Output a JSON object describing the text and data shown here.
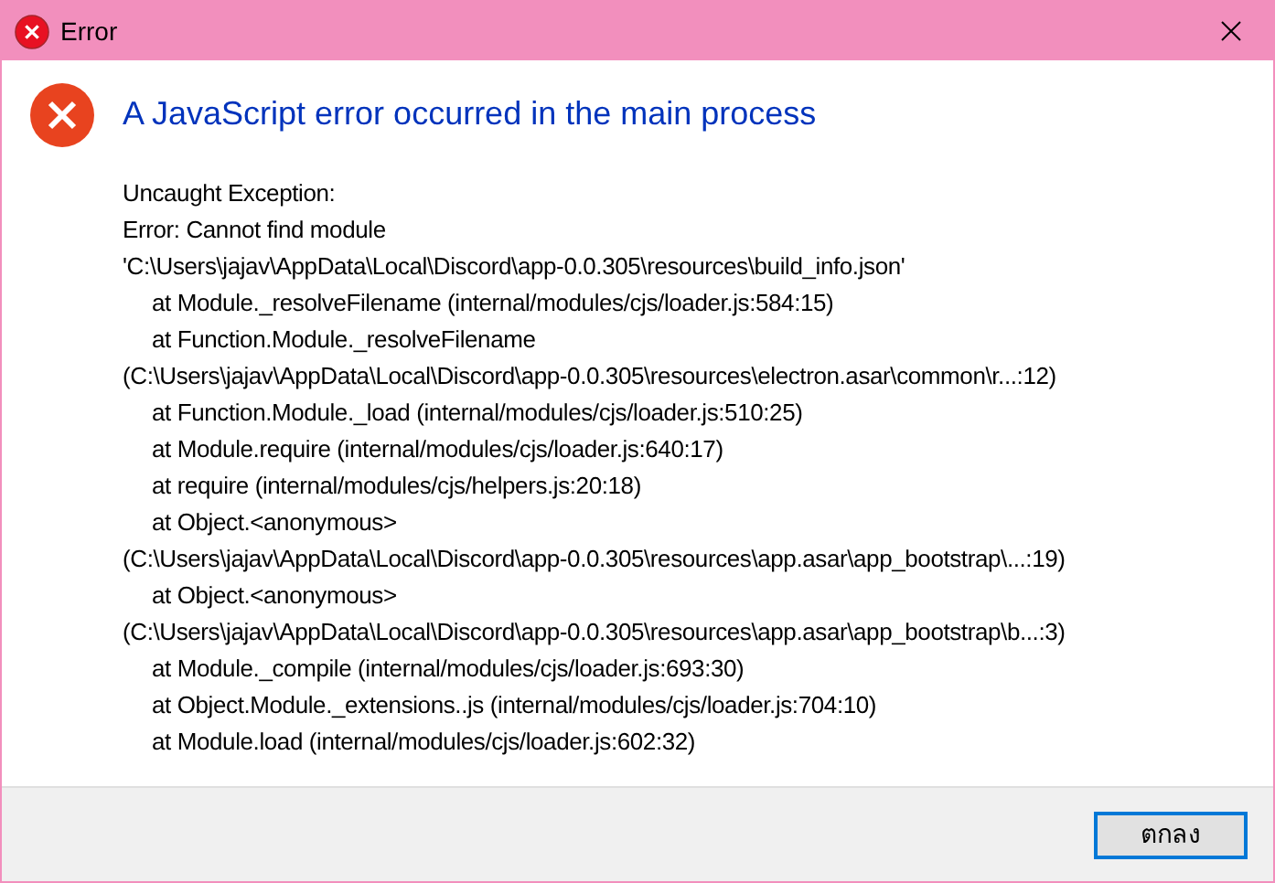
{
  "window": {
    "title": "Error"
  },
  "heading": "A JavaScript error occurred in the main process",
  "message_lines": [
    {
      "text": "Uncaught Exception:",
      "indent": false
    },
    {
      "text": "Error: Cannot find module",
      "indent": false
    },
    {
      "text": "'C:\\Users\\jajav\\AppData\\Local\\Discord\\app-0.0.305\\resources\\build_info.json'",
      "indent": false
    },
    {
      "text": "at Module._resolveFilename (internal/modules/cjs/loader.js:584:15)",
      "indent": true
    },
    {
      "text": "at Function.Module._resolveFilename",
      "indent": true
    },
    {
      "text": "(C:\\Users\\jajav\\AppData\\Local\\Discord\\app-0.0.305\\resources\\electron.asar\\common\\r...:12)",
      "indent": false
    },
    {
      "text": "at Function.Module._load (internal/modules/cjs/loader.js:510:25)",
      "indent": true
    },
    {
      "text": "at Module.require (internal/modules/cjs/loader.js:640:17)",
      "indent": true
    },
    {
      "text": "at require (internal/modules/cjs/helpers.js:20:18)",
      "indent": true
    },
    {
      "text": "at Object.<anonymous>",
      "indent": true
    },
    {
      "text": "(C:\\Users\\jajav\\AppData\\Local\\Discord\\app-0.0.305\\resources\\app.asar\\app_bootstrap\\...:19)",
      "indent": false
    },
    {
      "text": "at Object.<anonymous>",
      "indent": true
    },
    {
      "text": "(C:\\Users\\jajav\\AppData\\Local\\Discord\\app-0.0.305\\resources\\app.asar\\app_bootstrap\\b...:3)",
      "indent": false
    },
    {
      "text": "at Module._compile (internal/modules/cjs/loader.js:693:30)",
      "indent": true
    },
    {
      "text": "at Object.Module._extensions..js (internal/modules/cjs/loader.js:704:10)",
      "indent": true
    },
    {
      "text": "at Module.load (internal/modules/cjs/loader.js:602:32)",
      "indent": true
    }
  ],
  "buttons": [
    {
      "label": "ตกลง",
      "selected": true
    }
  ]
}
